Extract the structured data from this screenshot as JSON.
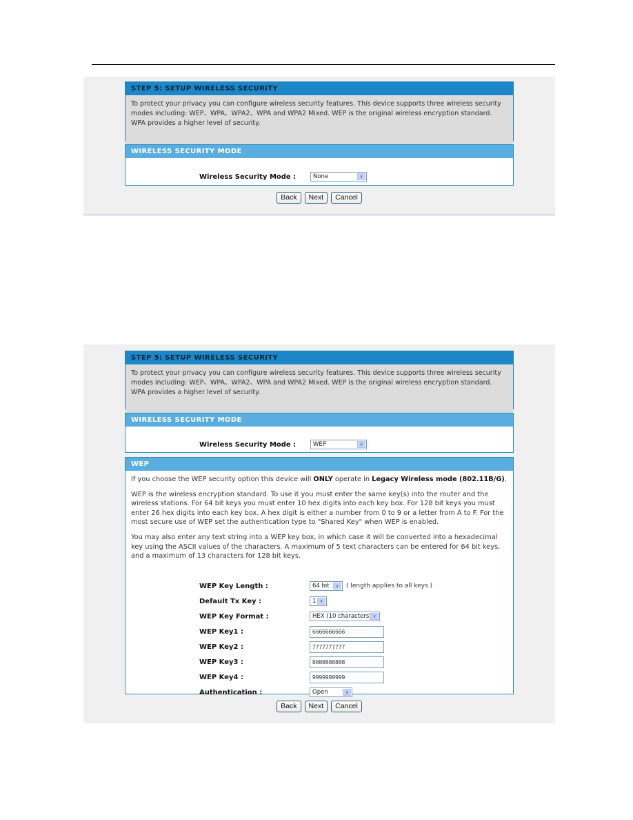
{
  "shot1": {
    "step_header": "STEP 5: SETUP WIRELESS SECURITY",
    "step_text": "To protect your privacy you can configure wireless security features. This device supports three wireless security modes including: WEP、WPA、WPA2、WPA and WPA2 Mixed. WEP is the original wireless encryption standard. WPA provides a higher level of security.",
    "mode_header": "WIRELESS SECURITY MODE",
    "mode_label": "Wireless Security Mode :",
    "mode_value": "None",
    "buttons": {
      "back": "Back",
      "next": "Next",
      "cancel": "Cancel"
    }
  },
  "shot2": {
    "step_header": "STEP 5: SETUP WIRELESS SECURITY",
    "step_text": "To protect your privacy you can configure wireless security features. This device supports three wireless security modes including: WEP、WPA、WPA2、WPA and WPA2 Mixed. WEP is the original wireless encryption standard. WPA provides a higher level of security.",
    "mode_header": "WIRELESS SECURITY MODE",
    "mode_label": "Wireless Security Mode :",
    "mode_value": "WEP",
    "wep": {
      "header": "WEP",
      "p1_pre": "If you choose the WEP security option this device will ",
      "p1_bold1": "ONLY",
      "p1_mid": " operate in ",
      "p1_bold2": "Legacy Wireless mode (802.11B/G)",
      "p1_post": ".",
      "p2": "WEP is the wireless encryption standard. To use it you must enter the same key(s) into the router and the wireless stations. For 64 bit keys you must enter 10 hex digits into each key box. For 128 bit keys you must enter 26 hex digits into each key box. A hex digit is either a number from 0 to 9 or a letter from A to F. For the most secure use of WEP set the authentication type to \"Shared Key\" when WEP is enabled.",
      "p3": "You may also enter any text string into a WEP key box, in which case it will be converted into a hexadecimal key using the ASCII values of the characters. A maximum of 5 text characters can be entered for 64 bit keys, and a maximum of 13 characters for 128 bit keys.",
      "fields": {
        "key_length_label": "WEP Key Length :",
        "key_length_value": "64 bit",
        "key_length_note": "( length applies to all keys )",
        "default_tx_label": "Default Tx Key :",
        "default_tx_value": "1",
        "key_format_label": "WEP Key Format :",
        "key_format_value": "HEX (10 characters)",
        "key1_label": "WEP Key1 :",
        "key1_value": "6666666666",
        "key2_label": "WEP Key2 :",
        "key2_value": "7777777777",
        "key3_label": "WEP Key3 :",
        "key3_value": "8888888888",
        "key4_label": "WEP Key4 :",
        "key4_value": "9999999999",
        "auth_label": "Authentication :",
        "auth_value": "Open"
      }
    },
    "buttons": {
      "back": "Back",
      "next": "Next",
      "cancel": "Cancel"
    }
  },
  "icons": {
    "dropdown_arrow": "∨"
  }
}
